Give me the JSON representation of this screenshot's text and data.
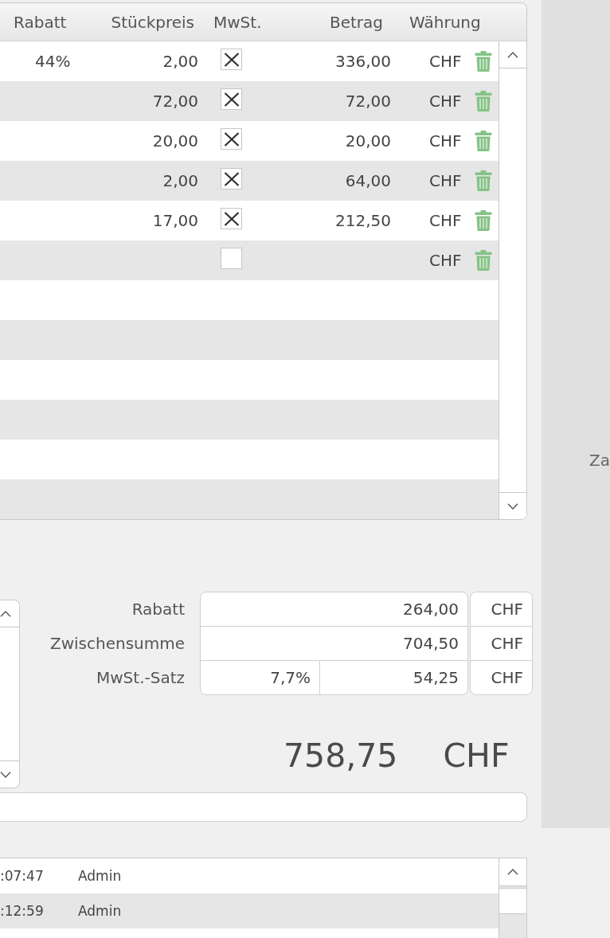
{
  "items_table": {
    "columns": [
      "Rabatt",
      "Stückpreis",
      "MwSt.",
      "Betrag",
      "Währung"
    ],
    "rows": [
      {
        "discount": "44%",
        "unit_price": "2,00",
        "vat": true,
        "amount": "336,00",
        "currency": "CHF"
      },
      {
        "unit_price": "72,00",
        "vat": true,
        "amount": "72,00",
        "currency": "CHF"
      },
      {
        "unit_price": "20,00",
        "vat": true,
        "amount": "20,00",
        "currency": "CHF"
      },
      {
        "unit_price": "2,00",
        "vat": true,
        "amount": "64,00",
        "currency": "CHF"
      },
      {
        "unit_price": "17,00",
        "vat": true,
        "amount": "212,50",
        "currency": "CHF"
      },
      {
        "vat": false,
        "currency": "CHF"
      }
    ]
  },
  "totals": {
    "rows": [
      {
        "kind": "single",
        "label": "Rabatt",
        "value": "264,00",
        "currency": "CHF"
      },
      {
        "kind": "single",
        "label": "Zwischensumme",
        "value": "704,50",
        "currency": "CHF"
      },
      {
        "kind": "split",
        "label": "MwSt.-Satz",
        "rate": "7,7%",
        "value": "54,25",
        "currency": "CHF"
      }
    ],
    "grand_total": {
      "value": "758,75",
      "currency": "CHF"
    }
  },
  "history": {
    "rows": [
      {
        "time": ":07:47",
        "user": "Admin"
      },
      {
        "time": ":12:59",
        "user": "Admin"
      }
    ]
  },
  "side_panel": {
    "labels": [
      "Za"
    ]
  }
}
